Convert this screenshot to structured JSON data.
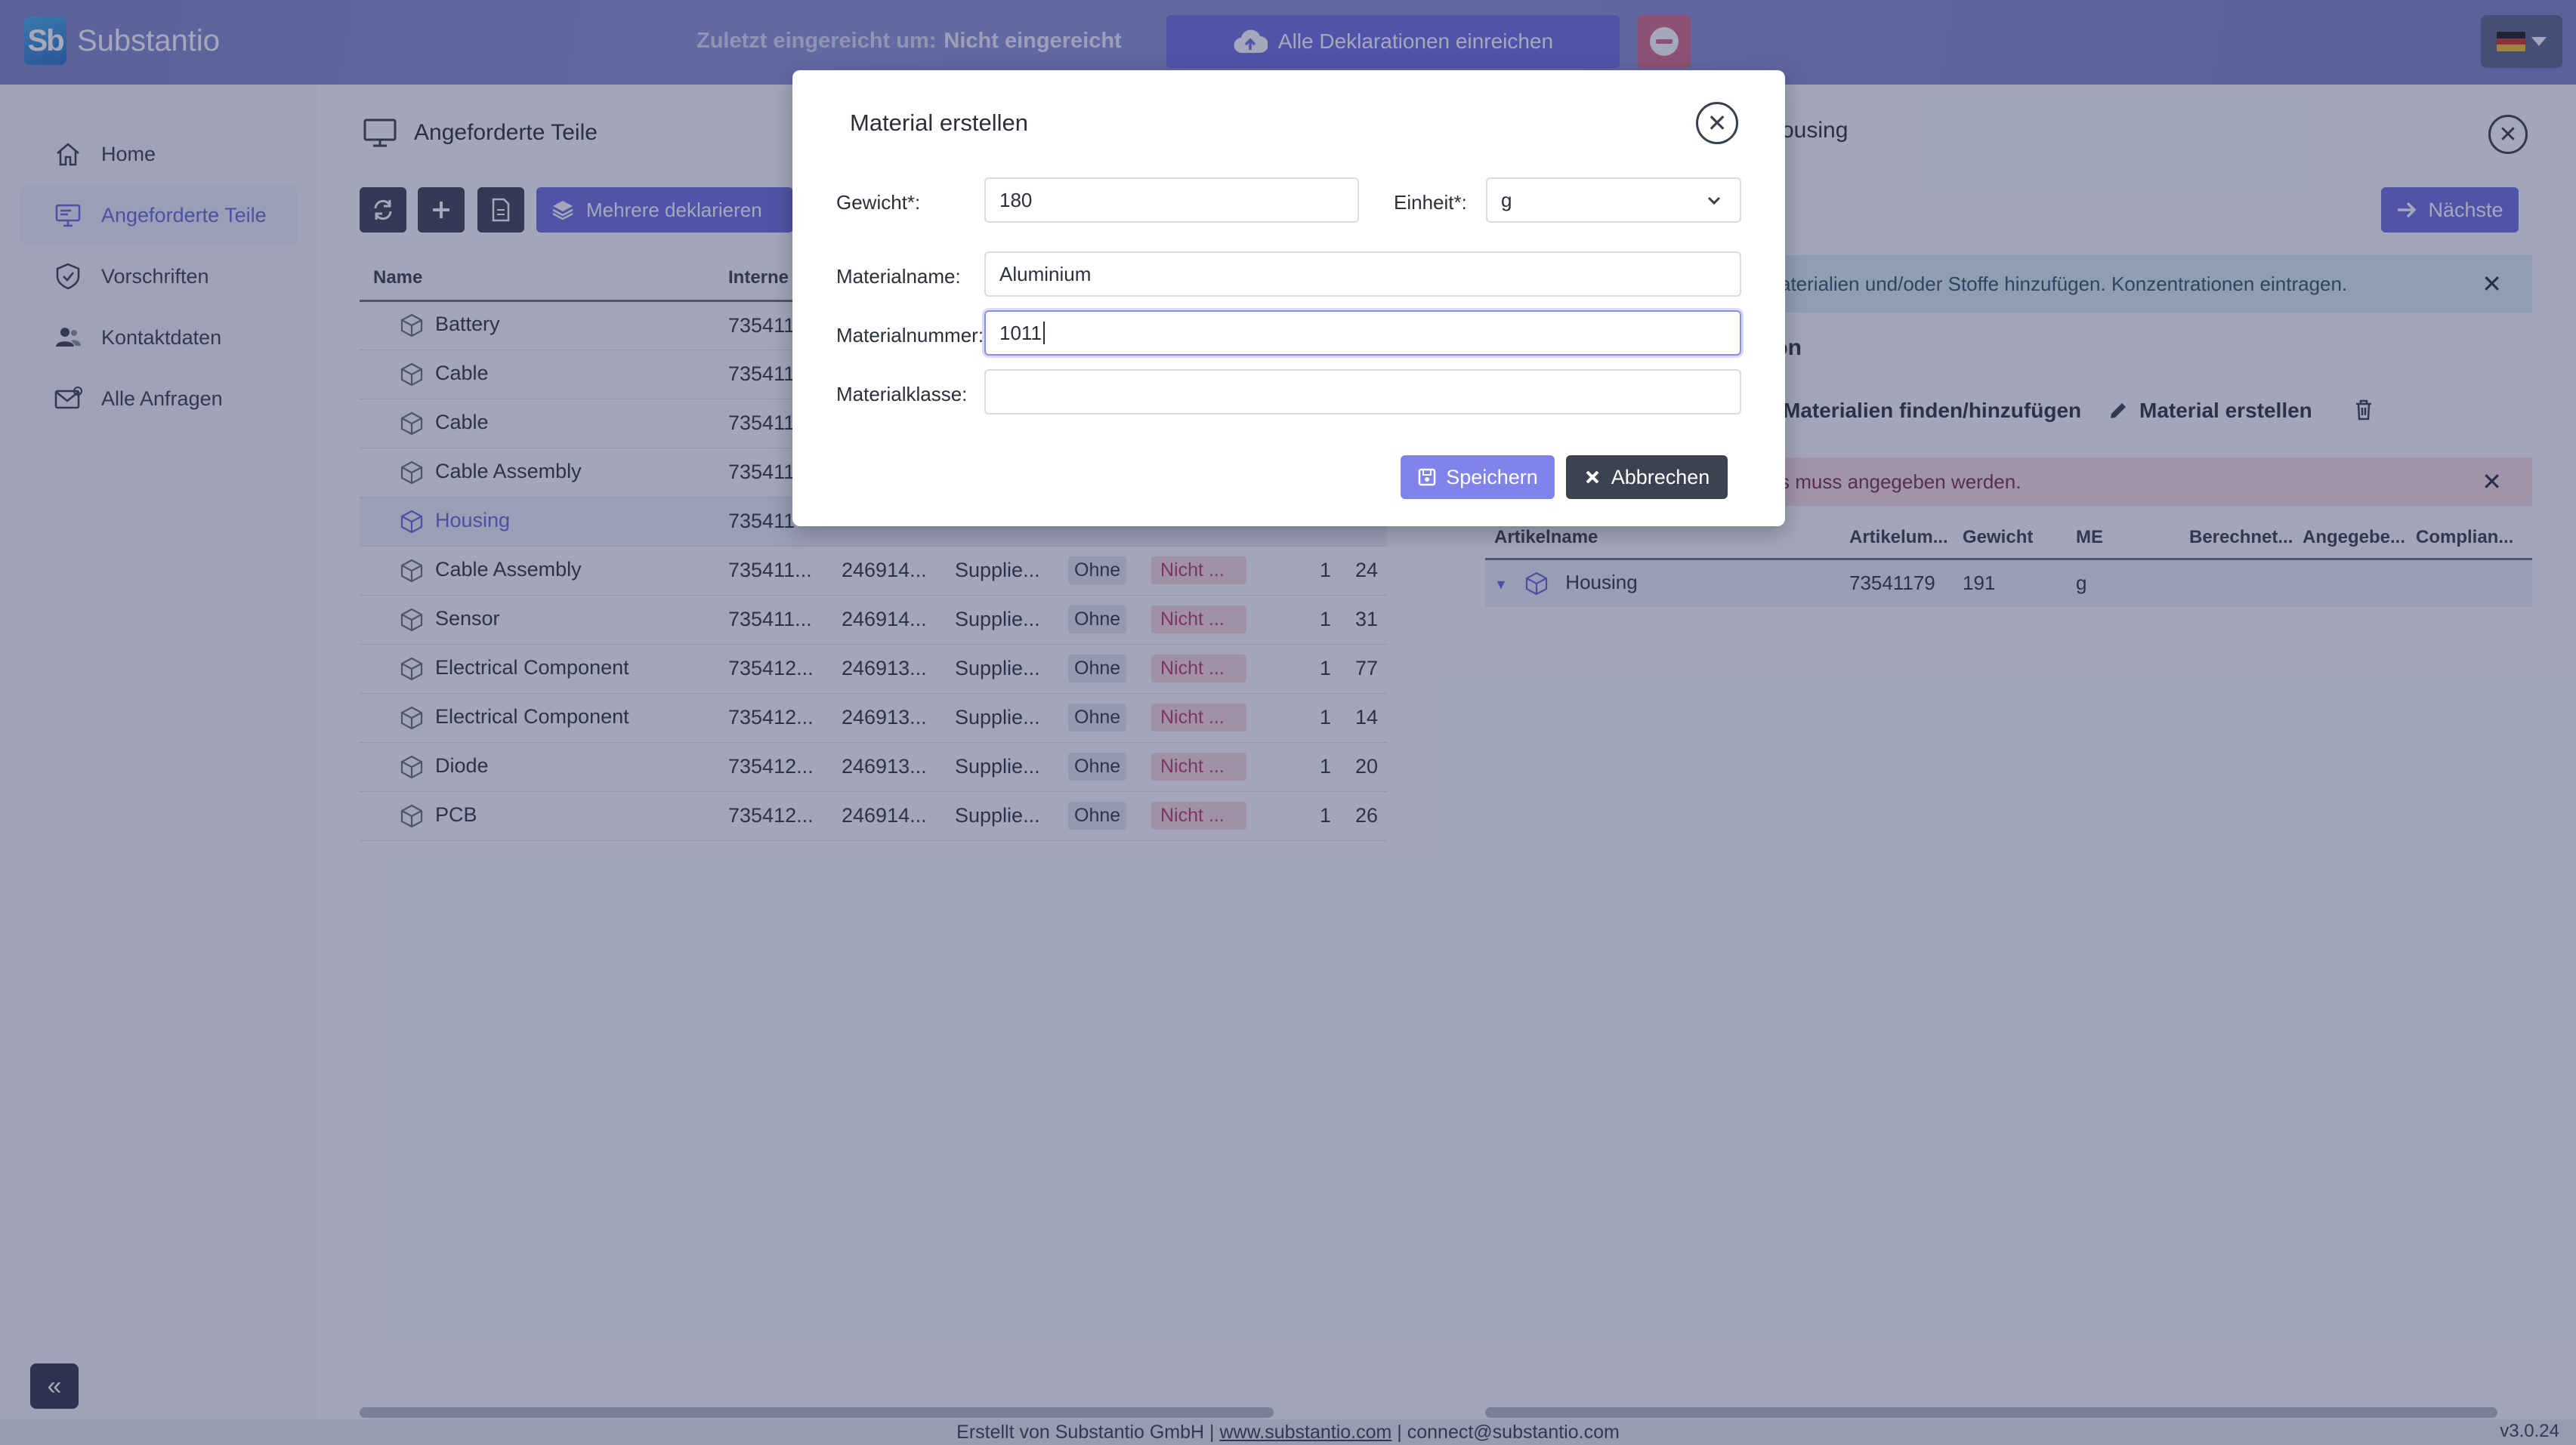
{
  "header": {
    "logo_mark": "Sb",
    "logo_text": "Substantio",
    "last_submitted_label": "Zuletzt eingereicht um:",
    "last_submitted_value": "Nicht eingereicht",
    "submit_all_label": "Alle Deklarationen einreichen",
    "flag_colors": [
      "#1a1a1a",
      "#d6332c",
      "#f2c230"
    ]
  },
  "sidebar": {
    "items": [
      {
        "label": "Home",
        "icon": "home-icon"
      },
      {
        "label": "Angeforderte Teile",
        "icon": "monitor-icon",
        "active": true
      },
      {
        "label": "Vorschriften",
        "icon": "shield-icon"
      },
      {
        "label": "Kontaktdaten",
        "icon": "contacts-icon"
      },
      {
        "label": "Alle Anfragen",
        "icon": "mail-icon"
      }
    ],
    "collapse_glyph": "«"
  },
  "parts_panel": {
    "title": "Angeforderte Teile",
    "multi_declare_label": "Mehrere deklarieren",
    "columns": [
      "Name",
      "Interne ..."
    ],
    "rows": [
      {
        "name": "Battery",
        "internal": "735411",
        "c3": "",
        "c4": "",
        "c5": "",
        "c6": "",
        "c7": "",
        "c8": ""
      },
      {
        "name": "Cable",
        "internal": "735411",
        "c3": "",
        "c4": "",
        "c5": "",
        "c6": "",
        "c7": "",
        "c8": ""
      },
      {
        "name": "Cable",
        "internal": "735411",
        "c3": "",
        "c4": "",
        "c5": "",
        "c6": "",
        "c7": "",
        "c8": ""
      },
      {
        "name": "Cable Assembly",
        "internal": "735411",
        "c3": "",
        "c4": "",
        "c5": "",
        "c6": "",
        "c7": "",
        "c8": ""
      },
      {
        "name": "Housing",
        "internal": "735411",
        "c3": "",
        "c4": "",
        "c5": "",
        "c6": "",
        "c7": "",
        "c8": "",
        "selected": true
      },
      {
        "name": "Cable Assembly",
        "internal": "735411...",
        "c3": "246914...",
        "c4": "Supplie...",
        "c5": "Ohne",
        "c6": "Nicht ...",
        "c7": "1",
        "c8": "24"
      },
      {
        "name": "Sensor",
        "internal": "735411...",
        "c3": "246914...",
        "c4": "Supplie...",
        "c5": "Ohne",
        "c6": "Nicht ...",
        "c7": "1",
        "c8": "31"
      },
      {
        "name": "Electrical Component",
        "internal": "735412...",
        "c3": "246913...",
        "c4": "Supplie...",
        "c5": "Ohne",
        "c6": "Nicht ...",
        "c7": "1",
        "c8": "77"
      },
      {
        "name": "Electrical Component",
        "internal": "735412...",
        "c3": "246913...",
        "c4": "Supplie...",
        "c5": "Ohne",
        "c6": "Nicht ...",
        "c7": "1",
        "c8": "14"
      },
      {
        "name": "Diode",
        "internal": "735412...",
        "c3": "246913...",
        "c4": "Supplie...",
        "c5": "Ohne",
        "c6": "Nicht ...",
        "c7": "1",
        "c8": "20"
      },
      {
        "name": "PCB",
        "internal": "735412...",
        "c3": "246914...",
        "c4": "Supplie...",
        "c5": "Ohne",
        "c6": "Nicht ...",
        "c7": "1",
        "c8": "26"
      }
    ]
  },
  "detail_panel": {
    "title_fragment": "ousing",
    "next_label": "Nächste",
    "info_text": "aterialien und/oder Stoffe hinzufügen. Konzentrationen eintragen.",
    "section_title_fragment": "ion",
    "find_add_label": "Materialien finden/hinzufügen",
    "create_material_label": "Material erstellen",
    "error_text": "s muss angegeben werden.",
    "columns": [
      "Artikelname",
      "Artikelum...",
      "Gewicht",
      "ME",
      "Berechnet...",
      "Angegebe...",
      "Complian..."
    ],
    "rows": [
      {
        "name": "Housing",
        "number": "73541179",
        "weight": "191",
        "unit": "g",
        "calc": "",
        "given": "",
        "compliance": ""
      }
    ]
  },
  "footer": {
    "prefix": "Erstellt von Substantio GmbH |",
    "link": "www.substantio.com",
    "suffix": "| connect@substantio.com",
    "version": "v3.0.24"
  },
  "modal": {
    "title": "Material erstellen",
    "weight_label": "Gewicht*:",
    "weight_value": "180",
    "unit_label": "Einheit*:",
    "unit_value": "g",
    "material_name_label": "Materialname:",
    "material_name_value": "Aluminium",
    "material_number_label": "Materialnummer:",
    "material_number_value": "1011",
    "material_class_label": "Materialklasse:",
    "material_class_value": "",
    "save_label": "Speichern",
    "cancel_label": "Abbrechen"
  },
  "colors": {
    "accent": "#6b6ee0",
    "dark_button": "#3b4252",
    "error_tag": "#c0395b",
    "info_bg": "#d9eef3",
    "error_bg": "#f6dce3"
  }
}
